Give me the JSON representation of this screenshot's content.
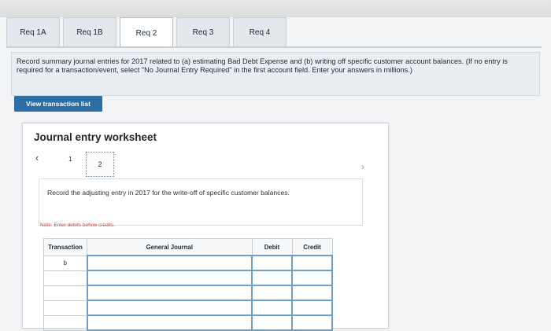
{
  "tabs": [
    {
      "label": "Req 1A",
      "active": false
    },
    {
      "label": "Req 1B",
      "active": false
    },
    {
      "label": "Req 2",
      "active": true
    },
    {
      "label": "Req 3",
      "active": false
    },
    {
      "label": "Req 4",
      "active": false
    }
  ],
  "instructions": "Record summary journal entries for 2017 related to (a) estimating Bad Debt Expense and (b) writing off specific customer account balances. (If no entry is required for a transaction/event, select \"No Journal Entry Required\" in the first account field. Enter your answers in millions.)",
  "view_button": "View transaction list",
  "worksheet": {
    "title": "Journal entry worksheet",
    "pages": [
      "1",
      "2"
    ],
    "description": "Record the adjusting entry in 2017 for the write-off of specific customer balances.",
    "note": "Note: Enter debits before credits.",
    "columns": [
      "Transaction",
      "General Journal",
      "Debit",
      "Credit"
    ],
    "rows": [
      {
        "transaction": "b"
      },
      {
        "transaction": ""
      },
      {
        "transaction": ""
      },
      {
        "transaction": ""
      },
      {
        "transaction": ""
      }
    ]
  }
}
